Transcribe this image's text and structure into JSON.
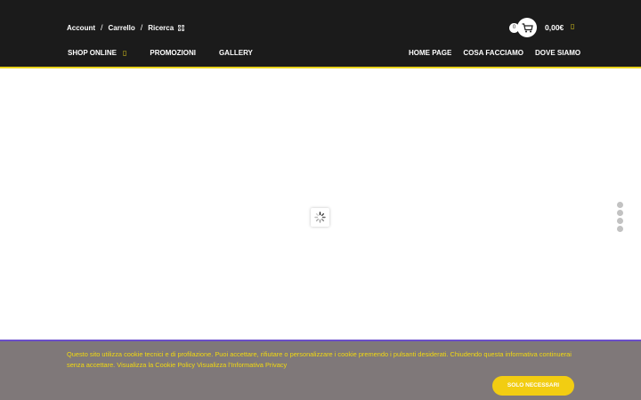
{
  "header": {
    "top_links": [
      "Account",
      "Carrello",
      "Ricerca"
    ],
    "separator": "/",
    "cart": {
      "count": "0",
      "total": "0,00€",
      "chevron": "▯"
    },
    "nav_left": [
      {
        "label": "SHOP ONLINE",
        "has_dropdown": true,
        "chevron": "▯"
      },
      {
        "label": "PROMOZIONI"
      },
      {
        "label": "GALLERY"
      }
    ],
    "nav_right": [
      "HOME PAGE",
      "COSA FACCIAMO",
      "DOVE SIAMO"
    ]
  },
  "main": {
    "loader_icon": "spinner-icon"
  },
  "side_dots": {
    "count": 4
  },
  "cookie": {
    "text": "Questo sito utilizza cookie tecnici e di profilazione. Puoi accettare, rifiutare o personalizzare i cookie premendo i pulsanti desiderati. Chiudendo questa informativa continuerai senza accettare. Visualizza la Cookie Policy Visualizza l'Informativa Privacy",
    "button": "SOLO NECESSARI"
  },
  "colors": {
    "accent": "#e8d31c",
    "header_bg": "#1b1b1b",
    "cookie_bg": "#7f7879",
    "cookie_text": "#f2d90f"
  }
}
